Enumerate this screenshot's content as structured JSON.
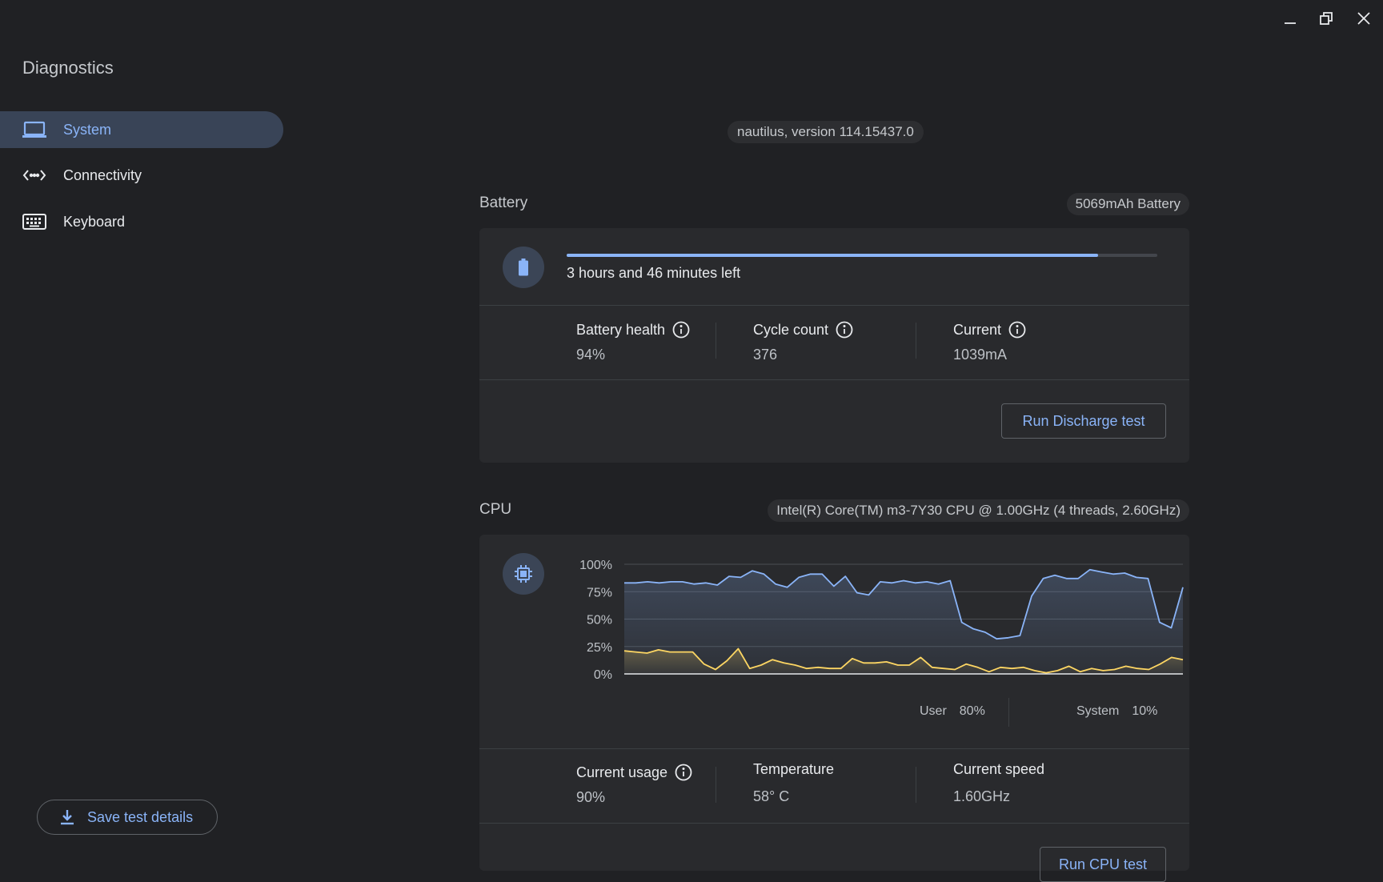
{
  "app": {
    "title": "Diagnostics"
  },
  "sidebar": {
    "items": [
      {
        "label": "System",
        "icon": "laptop-icon",
        "active": true
      },
      {
        "label": "Connectivity",
        "icon": "connectivity-icon",
        "active": false
      },
      {
        "label": "Keyboard",
        "icon": "keyboard-icon",
        "active": false
      }
    ],
    "save_label": "Save test details"
  },
  "header": {
    "version": "nautilus, version 114.15437.0"
  },
  "battery": {
    "title": "Battery",
    "chip": "5069mAh Battery",
    "time_left": "3 hours and 46 minutes left",
    "charge_fraction": 0.9,
    "health_label": "Battery health",
    "health_value": "94%",
    "cycle_label": "Cycle count",
    "cycle_value": "376",
    "current_label": "Current",
    "current_value": "1039mA",
    "button": "Run Discharge test"
  },
  "cpu": {
    "title": "CPU",
    "chip": "Intel(R) Core(TM) m3-7Y30 CPU @ 1.00GHz (4 threads, 2.60GHz)",
    "legend_user_label": "User",
    "legend_user_value": "80%",
    "legend_system_label": "System",
    "legend_system_value": "10%",
    "usage_label": "Current usage",
    "usage_value": "90%",
    "temp_label": "Temperature",
    "temp_value": "58° C",
    "speed_label": "Current speed",
    "speed_value": "1.60GHz",
    "button": "Run CPU test"
  },
  "colors": {
    "accent": "#8ab4f8",
    "user_series": "#8ab4f8",
    "system_series": "#fdd663",
    "active_nav": "#394457",
    "background": "#202124",
    "card": "#292a2d"
  },
  "chart_data": {
    "type": "area",
    "ylim": [
      0,
      100
    ],
    "ytick_labels": [
      "100%",
      "75%",
      "50%",
      "25%",
      "0%"
    ],
    "grid": true,
    "series": [
      {
        "name": "User",
        "color": "#8ab4f8",
        "values": [
          83,
          83,
          84,
          83,
          84,
          84,
          82,
          83,
          81,
          89,
          88,
          94,
          91,
          82,
          79,
          88,
          91,
          91,
          80,
          89,
          74,
          72,
          84,
          83,
          85,
          83,
          84,
          82,
          85,
          47,
          41,
          38,
          32,
          33,
          35,
          71,
          87,
          90,
          87,
          87,
          95,
          93,
          91,
          92,
          88,
          87,
          47,
          42,
          79
        ]
      },
      {
        "name": "System",
        "color": "#fdd663",
        "values": [
          21,
          20,
          19,
          22,
          20,
          20,
          20,
          9,
          4,
          12,
          23,
          5,
          8,
          13,
          10,
          8,
          5,
          6,
          5,
          5,
          14,
          10,
          10,
          11,
          8,
          8,
          15,
          6,
          5,
          4,
          9,
          6,
          2,
          6,
          5,
          6,
          3,
          1,
          3,
          7,
          2,
          5,
          3,
          4,
          7,
          5,
          4,
          9,
          15,
          13
        ]
      }
    ]
  }
}
